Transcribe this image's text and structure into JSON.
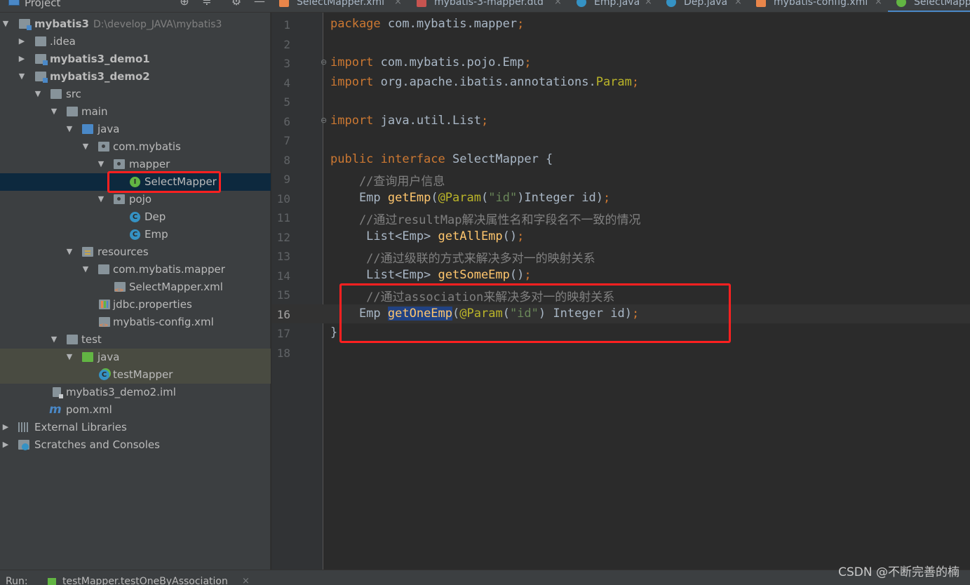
{
  "project_panel": {
    "title": "Project",
    "tools": [
      "locate-icon",
      "collapse-icon",
      "gear-icon",
      "minimize-icon"
    ]
  },
  "tabs": [
    {
      "label": "SelectMapper.xml",
      "icon": "xml-file-icon",
      "active": false
    },
    {
      "label": "mybatis-3-mapper.dtd",
      "icon": "dtd-file-icon",
      "active": false
    },
    {
      "label": "Emp.java",
      "icon": "class-icon",
      "active": false
    },
    {
      "label": "Dep.java",
      "icon": "class-icon",
      "active": false
    },
    {
      "label": "mybatis-config.xml",
      "icon": "xml-file-icon",
      "active": false
    },
    {
      "label": "SelectMapper",
      "icon": "interface-icon",
      "active": true
    }
  ],
  "tree": [
    {
      "label": "mybatis3",
      "hint": "D:\\develop_JAVA\\mybatis3",
      "bold": true,
      "arrow": "down",
      "icon": "module-icon"
    },
    {
      "label": ".idea",
      "arrow": "right",
      "icon": "folder-icon"
    },
    {
      "label": "mybatis3_demo1",
      "bold": true,
      "arrow": "right",
      "icon": "module-icon"
    },
    {
      "label": "mybatis3_demo2",
      "bold": true,
      "arrow": "down",
      "icon": "module-icon"
    },
    {
      "label": "src",
      "arrow": "down",
      "icon": "folder-icon"
    },
    {
      "label": "main",
      "arrow": "down",
      "icon": "folder-icon"
    },
    {
      "label": "java",
      "arrow": "down",
      "icon": "source-folder-icon"
    },
    {
      "label": "com.mybatis",
      "arrow": "down",
      "icon": "package-icon"
    },
    {
      "label": "mapper",
      "arrow": "down",
      "icon": "package-icon"
    },
    {
      "label": "SelectMapper",
      "arrow": "",
      "icon": "interface-icon",
      "selected": true
    },
    {
      "label": "pojo",
      "arrow": "down",
      "icon": "package-icon"
    },
    {
      "label": "Dep",
      "arrow": "",
      "icon": "class-icon"
    },
    {
      "label": "Emp",
      "arrow": "",
      "icon": "class-icon"
    },
    {
      "label": "resources",
      "arrow": "down",
      "icon": "resources-folder-icon"
    },
    {
      "label": "com.mybatis.mapper",
      "arrow": "down",
      "icon": "folder-icon"
    },
    {
      "label": "SelectMapper.xml",
      "arrow": "",
      "icon": "xml-file-icon"
    },
    {
      "label": "jdbc.properties",
      "arrow": "",
      "icon": "properties-file-icon"
    },
    {
      "label": "mybatis-config.xml",
      "arrow": "",
      "icon": "xml-file-icon"
    },
    {
      "label": "test",
      "arrow": "down",
      "icon": "folder-icon"
    },
    {
      "label": "java",
      "arrow": "down",
      "icon": "test-folder-icon",
      "highlight": true
    },
    {
      "label": "testMapper",
      "arrow": "",
      "icon": "test-class-icon",
      "highlight": true
    },
    {
      "label": "mybatis3_demo2.iml",
      "arrow": "",
      "icon": "iml-file-icon"
    },
    {
      "label": "pom.xml",
      "arrow": "",
      "icon": "maven-icon"
    },
    {
      "label": "External Libraries",
      "arrow": "right",
      "icon": "libraries-icon"
    },
    {
      "label": "Scratches and Consoles",
      "arrow": "right",
      "icon": "scratches-icon"
    }
  ],
  "editor": {
    "current_line": 16,
    "line_numbers": [
      "1",
      "2",
      "3",
      "4",
      "5",
      "6",
      "7",
      "8",
      "9",
      "10",
      "11",
      "12",
      "13",
      "14",
      "15",
      "16",
      "17",
      "18"
    ],
    "code": {
      "l1_kw": "package",
      "l1_rest": " com.mybatis.mapper",
      "l1_semi": ";",
      "l3_kw": "import",
      "l3_rest": " com.mybatis.pojo.Emp",
      "l3_semi": ";",
      "l4_kw": "import",
      "l4_rest": " org.apache.ibatis.annotations.",
      "l4_ann": "Param",
      "l4_semi": ";",
      "l6_kw": "import",
      "l6_rest": " java.util.List",
      "l6_semi": ";",
      "l8_kw": "public interface",
      "l8_rest": " SelectMapper {",
      "l9_comment": "    //查询用户信息",
      "l10_type": "    Emp ",
      "l10_fn": "getEmp",
      "l10_p1": "(",
      "l10_ann": "@Param",
      "l10_p2": "(",
      "l10_str": "\"id\"",
      "l10_rest": ")Integer id)",
      "l10_semi": ";",
      "l11_comment": "    //通过resultMap解决属性名和字段名不一致的情况",
      "l12_type": "     List<Emp> ",
      "l12_fn": "getAllEmp",
      "l12_rest": "()",
      "l12_semi": ";",
      "l13_comment": "     //通过级联的方式来解决多对一的映射关系",
      "l14_type": "     List<Emp> ",
      "l14_fn": "getSomeEmp",
      "l14_rest": "()",
      "l14_semi": ";",
      "l15_comment": "     //通过association来解决多对一的映射关系",
      "l16_type": "    Emp ",
      "l16_fn": "getOneEmp",
      "l16_p1": "(",
      "l16_ann": "@Param",
      "l16_p2": "(",
      "l16_str": "\"id\"",
      "l16_rest": ") Integer id)",
      "l16_semi": ";",
      "l17_brace": "}"
    }
  },
  "bottom_bar": {
    "run_label": "Run:",
    "run_config": "testMapper.testOneByAssociation",
    "close": "×"
  },
  "watermark": "CSDN @不断完善的楠",
  "colors": {
    "keyword": "#cc7832",
    "function": "#ffc66d",
    "annotation": "#bbb529",
    "string": "#6a8759",
    "comment": "#808080",
    "highlight_box": "#ff2020",
    "selection": "#214283"
  }
}
